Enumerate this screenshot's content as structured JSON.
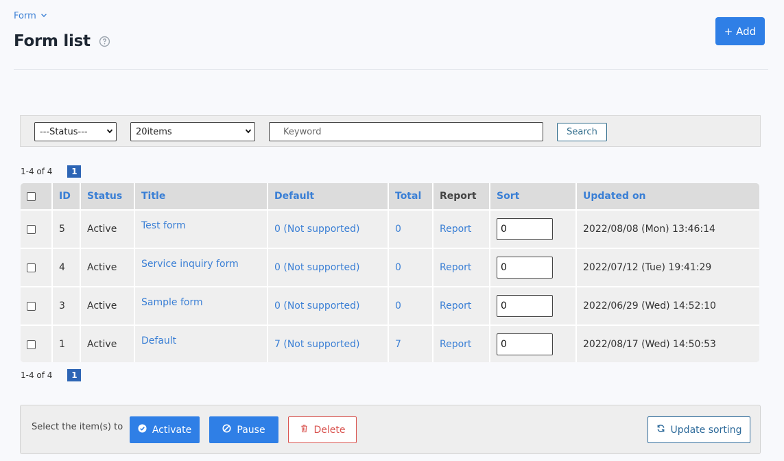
{
  "breadcrumb": {
    "label": "Form"
  },
  "page": {
    "title": "Form list"
  },
  "header": {
    "add_label": "+ Add"
  },
  "filters": {
    "status_selected": "---Status---",
    "count_selected": "20items",
    "keyword_placeholder": "Keyword",
    "search_label": "Search"
  },
  "pagination": {
    "range_text": "1-4 of 4",
    "current_page": "1"
  },
  "table": {
    "headers": {
      "id": "ID",
      "status": "Status",
      "title": "Title",
      "default": "Default",
      "total": "Total",
      "report": "Report",
      "sort": "Sort",
      "updated": "Updated on"
    },
    "rows": [
      {
        "id": "5",
        "status": "Active",
        "title": "Test form",
        "default": "0 (Not supported)",
        "total": "0",
        "report": "Report",
        "sort": "0",
        "updated": "2022/08/08 (Mon) 13:46:14"
      },
      {
        "id": "4",
        "status": "Active",
        "title": "Service inquiry form",
        "default": "0 (Not supported)",
        "total": "0",
        "report": "Report",
        "sort": "0",
        "updated": "2022/07/12 (Tue) 19:41:29"
      },
      {
        "id": "3",
        "status": "Active",
        "title": "Sample form",
        "default": "0 (Not supported)",
        "total": "0",
        "report": "Report",
        "sort": "0",
        "updated": "2022/06/29 (Wed) 14:52:10"
      },
      {
        "id": "1",
        "status": "Active",
        "title": "Default",
        "default": "7 (Not supported)",
        "total": "7",
        "report": "Report",
        "sort": "0",
        "updated": "2022/08/17 (Wed) 14:50:53"
      }
    ]
  },
  "actions": {
    "label": "Select the item(s) to",
    "activate": "Activate",
    "pause": "Pause",
    "delete": "Delete",
    "update_sorting": "Update sorting"
  },
  "colors": {
    "primary": "#2f7fe6",
    "link": "#3a7fd5",
    "danger": "#d9534f",
    "page_badge": "#2d65b5"
  },
  "icons": {
    "breadcrumb": "chevron-down-icon",
    "help": "question-circle-icon",
    "activate": "check-circle-icon",
    "pause": "ban-icon",
    "delete": "trash-icon",
    "update_sorting": "refresh-icon"
  }
}
